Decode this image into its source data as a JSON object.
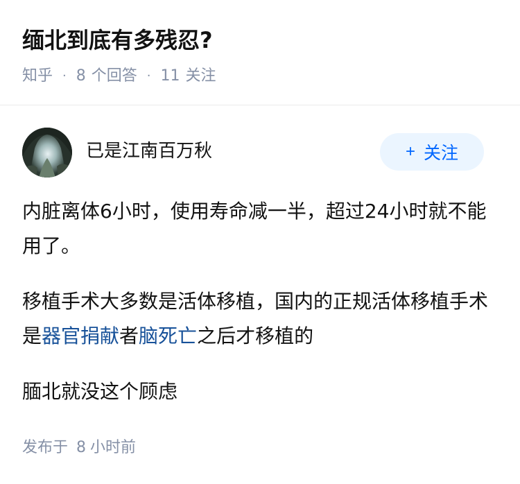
{
  "question": {
    "title": "缅北到底有多残忍?",
    "source": "知乎",
    "answer_count": "8",
    "answer_label": "个回答",
    "follow_count": "11",
    "follow_label": "关注"
  },
  "answer": {
    "author_name": "已是江南百万秋",
    "follow_button": {
      "plus": "+",
      "label": "关注"
    },
    "paragraphs": [
      {
        "text": "内脏离体6小时，使用寿命减一半，超过24小时就不能用了。"
      },
      {
        "pre": "移植手术大多数是活体移植，国内的正规活体移植手术是",
        "link1": "器官捐献",
        "mid": "者",
        "link2": "脑死亡",
        "post": "之后才移植的"
      },
      {
        "text": "腼北就没这个顾虑"
      }
    ],
    "published_label": "发布于",
    "published_num": "8",
    "published_unit": "小时前"
  },
  "colors": {
    "accent": "#0066ff",
    "link": "#175199",
    "follow_bg": "#ebf5ff",
    "meta_gray": "#8590a6"
  },
  "icons": {
    "avatar": "cave-photo-avatar"
  }
}
